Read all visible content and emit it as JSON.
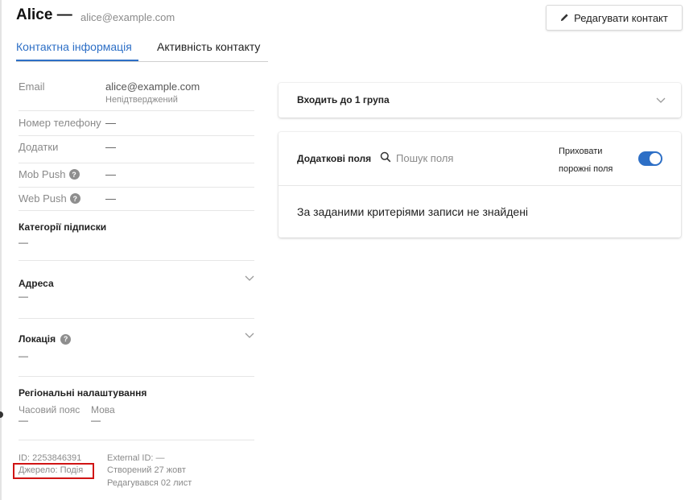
{
  "header": {
    "name": "Alice —",
    "email": "alice@example.com",
    "edit_button": "Редагувати контакт"
  },
  "tabs": [
    {
      "label": "Контактна інформація",
      "active": true
    },
    {
      "label": "Активність контакту",
      "active": false
    }
  ],
  "fields": {
    "email": {
      "label": "Email",
      "value": "alice@example.com",
      "status": "Непідтверджений"
    },
    "phone": {
      "label": "Номер телефону",
      "value": "—"
    },
    "apps": {
      "label": "Додатки",
      "value": "—"
    },
    "mob_push": {
      "label": "Mob Push",
      "value": "—"
    },
    "web_push": {
      "label": "Web Push",
      "value": "—"
    }
  },
  "sections": {
    "subscription": {
      "title": "Категорії підписки",
      "value": "—"
    },
    "address": {
      "title": "Адреса",
      "value": "—"
    },
    "location": {
      "title": "Локація",
      "value": "—"
    },
    "regional": {
      "title": "Регіональні налаштування",
      "timezone_label": "Часовий пояс",
      "timezone_value": "—",
      "language_label": "Мова",
      "language_value": "—"
    }
  },
  "meta": {
    "id": "ID: 2253846391",
    "source": "Джерело:  Подія",
    "external_id": "External ID: —",
    "created": "Створений 27 жовт",
    "edited": "Редагувався 02 лист"
  },
  "groups_card": {
    "title": "Входить до  1  група"
  },
  "extra_fields_card": {
    "title": "Додаткові поля",
    "search_placeholder": "Пошук поля",
    "hide_empty_label": "Приховати порожні поля",
    "hide_empty_enabled": true,
    "empty_message": "За заданими критеріями записи не знайдені"
  },
  "colors": {
    "accent": "#2d6fc6",
    "highlight_box": "#d01414"
  }
}
